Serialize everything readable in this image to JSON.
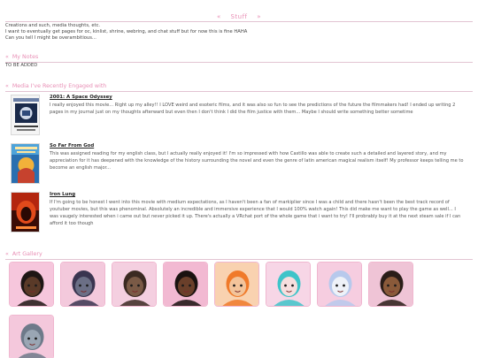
{
  "header": {
    "title": "Stuff",
    "deco_left": "«",
    "deco_right": "»"
  },
  "intro": {
    "lines": [
      "Creations and such, media thoughts, etc.",
      "I want to eventually get pages for oc, kinlist, shrine, webring, and chat stuff but for now this is fine HAHA",
      "Can you tell I might be overambitious..."
    ]
  },
  "notes": {
    "heading": "My Notes",
    "deco": "«",
    "body": "TO BE ADDED"
  },
  "media": {
    "heading": "Media I've Recently Engaged with",
    "deco": "«",
    "items": [
      {
        "title": "2001: A Space Odyssey",
        "body": "I really enjoyed this movie... Right up my alley!! I LOVE weird and esoteric films, and it was also so fun to see the predictions of the future the filmmakers had! I ended up writing 2 pages in my journal just on my thoughts afterward but even then I don't think I did the film justice with them... Maybe I should write something better sometime",
        "poster": "2001-poster"
      },
      {
        "title": "So Far From God",
        "body": "This was assigned reading for my english class, but I actually really enjoyed it! I'm so impressed with how Castillo was able to create such a detailed and layered story, and my appreciation for it has deepened with the knowledge of the history surrounding the novel and even the genre of latin american magical realism itself! My professor keeps telling me to become an english major...",
        "poster": "so-far-from-god-cover"
      },
      {
        "title": "Iron Lung",
        "body": "If I'm going to be honest I went into this movie with medium expectations, as I haven't been a fan of markiplier since I was a child and there hasn't been the best track record of youtuber movies, but this was phenominal. Absolutely an incredible and immersive experience that I would 100% watch again! This did make me want to play the game as well... I was vaugely interested when i came out but never picked it up. There's actually a VRchat port of the whole game that i want to try! I'll probrably buy it at the next steam sale if I can afford it too though",
        "poster": "iron-lung-poster"
      }
    ]
  },
  "gallery": {
    "heading": "Art Gallery",
    "deco": "«",
    "items": [
      {
        "name": "art-curly-hair-character",
        "bg": "#f6c6dc",
        "skin": "#5a3a28",
        "hair": "#1e1614"
      },
      {
        "name": "art-wolf-character",
        "bg": "#f3c9dc",
        "skin": "#6b6f86",
        "hair": "#3a3550"
      },
      {
        "name": "art-otter-character",
        "bg": "#f4cfe0",
        "skin": "#7a5a46",
        "hair": "#3b2a22"
      },
      {
        "name": "art-short-hair-character",
        "bg": "#f2b9d2",
        "skin": "#6a3f2a",
        "hair": "#1a1210"
      },
      {
        "name": "art-orange-hair-character",
        "bg": "#f9d2b0",
        "skin": "#f3c49a",
        "hair": "#f07a2a"
      },
      {
        "name": "art-teal-twintail-character",
        "bg": "#f7d6e6",
        "skin": "#f6dede",
        "hair": "#3ec4c9"
      },
      {
        "name": "art-white-fox-character",
        "bg": "#f6cde0",
        "skin": "#eef2f8",
        "hair": "#b7c9ec"
      },
      {
        "name": "art-bearded-character",
        "bg": "#efc4d6",
        "skin": "#8a5a3a",
        "hair": "#2a1d18"
      },
      {
        "name": "art-grey-cat-character",
        "bg": "#f4c8dc",
        "skin": "#9aa6b4",
        "hair": "#6e7a8a"
      }
    ]
  },
  "colors": {
    "accent": "#e88fb5",
    "rule": "#e2c4d2",
    "text": "#3a3a3a"
  }
}
